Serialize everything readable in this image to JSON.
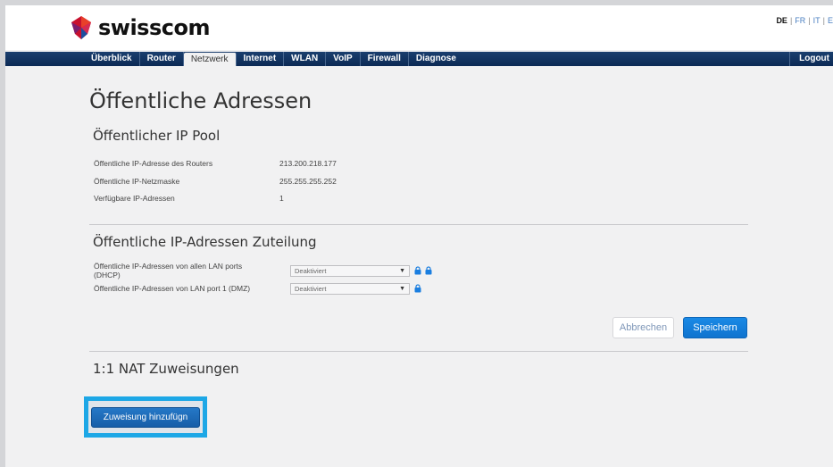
{
  "header": {
    "brand": "swisscom",
    "languages": [
      {
        "code": "DE",
        "active": true
      },
      {
        "code": "FR",
        "active": false
      },
      {
        "code": "IT",
        "active": false
      },
      {
        "code": "E",
        "active": false
      }
    ]
  },
  "nav": {
    "items": [
      {
        "label": "Überblick",
        "active": false
      },
      {
        "label": "Router",
        "active": false
      },
      {
        "label": "Netzwerk",
        "active": true
      },
      {
        "label": "Internet",
        "active": false
      },
      {
        "label": "WLAN",
        "active": false
      },
      {
        "label": "VoIP",
        "active": false
      },
      {
        "label": "Firewall",
        "active": false
      },
      {
        "label": "Diagnose",
        "active": false
      }
    ],
    "logout": "Logout"
  },
  "page": {
    "title": "Öffentliche Adressen"
  },
  "ip_pool": {
    "title": "Öffentlicher IP Pool",
    "rows": [
      {
        "label": "Öffentliche IP-Adresse des Routers",
        "value": "213.200.218.177"
      },
      {
        "label": "Öffentliche IP-Netzmaske",
        "value": "255.255.255.252"
      },
      {
        "label": "Verfügbare IP-Adressen",
        "value": "1"
      }
    ]
  },
  "assignment": {
    "title": "Öffentliche IP-Adressen Zuteilung",
    "rows": [
      {
        "label_line1": "Öffentliche IP-Adressen von allen LAN ports",
        "label_line2": "(DHCP)",
        "selected": "Deaktiviert",
        "locks": 2
      },
      {
        "label_line1": "Öffentliche IP-Adressen von LAN port 1 (DMZ)",
        "label_line2": "",
        "selected": "Deaktiviert",
        "locks": 1
      }
    ],
    "cancel_label": "Abbrechen",
    "save_label": "Speichern"
  },
  "nat": {
    "title": "1:1 NAT Zuweisungen",
    "add_label": "Zuweisung hinzufügn"
  },
  "colors": {
    "nav_bg": "#0c2a55",
    "primary_button": "#1a8ae6",
    "highlight": "#1da7e6",
    "lock_icon": "#1a7ee0"
  }
}
